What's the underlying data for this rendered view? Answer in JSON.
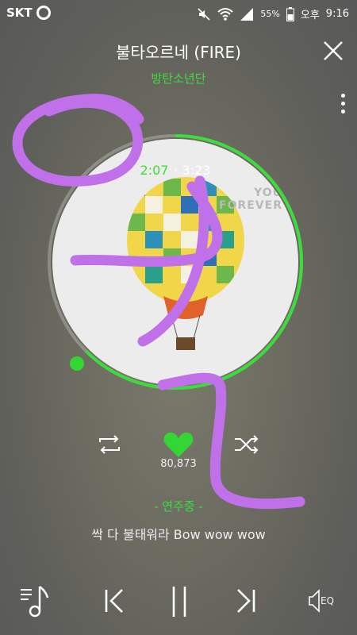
{
  "status_bar": {
    "carrier": "SKT",
    "battery": "55%",
    "ampm": "오후",
    "time": "9:16"
  },
  "header": {
    "title": "불타오르네 (FIRE)",
    "artist": "방탄소년단"
  },
  "player": {
    "current_time": "2:07",
    "separator": "·",
    "total_time": "3:23",
    "progress": 0.625,
    "album_art_text": [
      "YOU",
      "FOREVER"
    ],
    "likes": "80,873",
    "now_playing": "- 연주중 -",
    "lyric": "싹 다 불태워라 Bow wow wow"
  },
  "bottom_bar": {
    "eq_label": "EQ"
  },
  "colors": {
    "accent": "#3ddc3d",
    "scribble": "#c070e8"
  },
  "icons": [
    "wifi-icon",
    "signal-icon",
    "battery-icon",
    "mute-icon",
    "close-icon",
    "more-icon",
    "repeat-icon",
    "heart-icon",
    "shuffle-icon",
    "playlist-icon",
    "prev-icon",
    "pause-icon",
    "next-icon",
    "eq-icon"
  ]
}
